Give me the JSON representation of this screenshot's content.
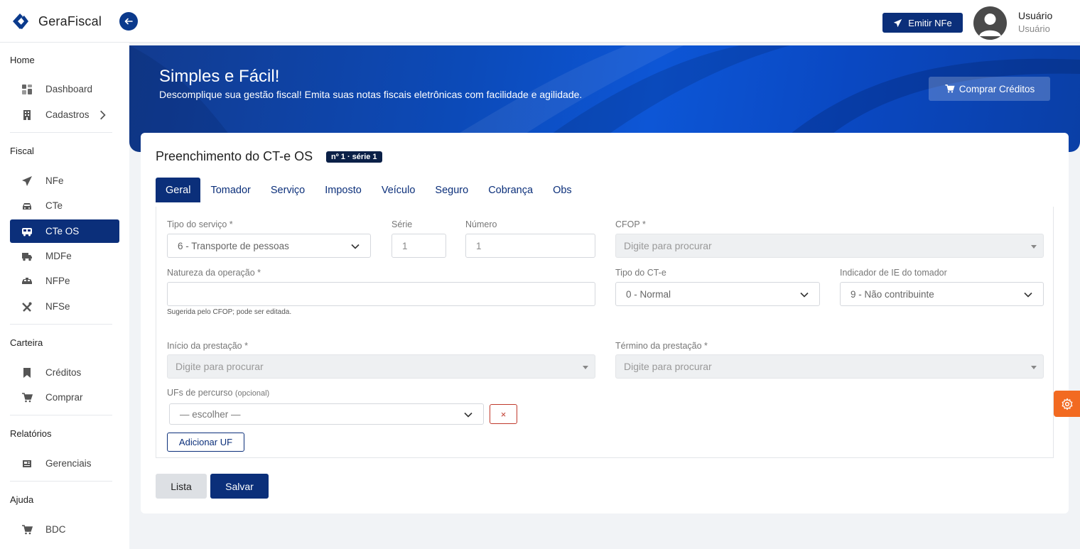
{
  "brand": {
    "name": "GeraFiscal",
    "logo_icon": "gerafiscal-logo-icon"
  },
  "header": {
    "emit_label": "Emitir NFe",
    "user_name": "Usuário",
    "user_role": "Usuário"
  },
  "sidebar": {
    "sections": [
      {
        "title": "Home",
        "items": [
          {
            "label": "Dashboard",
            "icon": "grid-icon"
          },
          {
            "label": "Cadastros",
            "icon": "building-icon"
          }
        ]
      },
      {
        "title": "Fiscal",
        "items": [
          {
            "label": "NFe",
            "icon": "paper-plane-icon"
          },
          {
            "label": "CTe",
            "icon": "car-icon"
          },
          {
            "label": "CTe OS",
            "icon": "bus-icon",
            "active": true
          },
          {
            "label": "MDFe",
            "icon": "truck-icon"
          },
          {
            "label": "NFPe",
            "icon": "taxi-icon"
          },
          {
            "label": "NFSe",
            "icon": "tools-icon"
          }
        ]
      },
      {
        "title": "Carteira",
        "items": [
          {
            "label": "Créditos",
            "icon": "bookmark-icon"
          },
          {
            "label": "Comprar",
            "icon": "cart-icon"
          }
        ]
      },
      {
        "title": "Relatórios",
        "items": [
          {
            "label": "Gerenciais",
            "icon": "newspaper-icon"
          }
        ]
      },
      {
        "title": "Ajuda",
        "items": [
          {
            "label": "BDC",
            "icon": "cart-icon"
          }
        ]
      }
    ]
  },
  "banner": {
    "title": "Simples e Fácil!",
    "subtitle": "Descomplique sua gestão fiscal! Emita suas notas fiscais eletrônicas com facilidade e agilidade.",
    "buy_label": "Comprar Créditos"
  },
  "form": {
    "title": "Preenchimento do CT-e OS",
    "badge": "nº 1 · série 1",
    "tabs": [
      "Geral",
      "Tomador",
      "Serviço",
      "Imposto",
      "Veículo",
      "Seguro",
      "Cobrança",
      "Obs"
    ],
    "active_tab": "Geral",
    "fields": {
      "tipo_servico": {
        "label": "Tipo do serviço *",
        "value": "6 - Transporte de pessoas"
      },
      "serie": {
        "label": "Série",
        "placeholder": "1"
      },
      "numero": {
        "label": "Número",
        "placeholder": "1"
      },
      "cfop": {
        "label": "CFOP *",
        "placeholder": "Digite para procurar"
      },
      "natureza": {
        "label": "Natureza da operação *",
        "value": "",
        "hint": "Sugerida pelo CFOP; pode ser editada."
      },
      "tipo_cte": {
        "label": "Tipo do CT-e",
        "value": "0 - Normal"
      },
      "indicador_ie": {
        "label": "Indicador de IE do tomador",
        "value": "9 - Não contribuinte"
      },
      "inicio": {
        "label": "Início da prestação *",
        "placeholder": "Digite para procurar"
      },
      "termino": {
        "label": "Término da prestação *",
        "placeholder": "Digite para procurar"
      },
      "ufs": {
        "label": "UFs de percurso",
        "label_note": "(opcional)",
        "value": "— escolher —",
        "remove_label": "×"
      }
    },
    "add_uf_label": "Adicionar UF",
    "list_label": "Lista",
    "save_label": "Salvar"
  },
  "colors": {
    "primary": "#0b2f7a",
    "accent": "#f26a21",
    "danger": "#c0392b"
  }
}
